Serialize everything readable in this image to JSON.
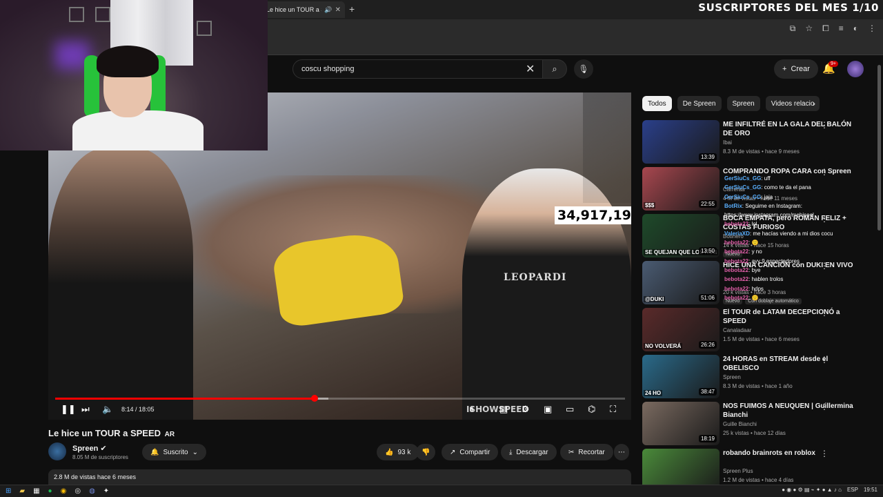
{
  "overlay": {
    "title": "SUSCRIPTORES DEL MES 1/10",
    "viewer_counter": "34,917,19"
  },
  "browser": {
    "tab_title": "Le hice un TOUR a SP",
    "new_tab": "+",
    "close": "✕"
  },
  "header": {
    "search_value": "coscu shopping",
    "create_label": "Crear",
    "notif_count": "9+"
  },
  "player": {
    "current_time": "8:14",
    "duration": "18:05",
    "time_display": "8:14 / 18:05",
    "progress": 0.455,
    "shirt_print": "LEOPARDI",
    "watermark": "ISHOWSPEED"
  },
  "video": {
    "title": "Le hice un TOUR a SPEED",
    "title_flag": "AR",
    "channel": "Spreen",
    "subscribers": "8.05 M de suscriptores",
    "subscribed_label": "Suscrito",
    "likes": "93 k",
    "share_label": "Compartir",
    "download_label": "Descargar",
    "clip_label": "Recortar",
    "views_date": "2.8 M de vistas  hace 6 meses"
  },
  "chips": [
    "Todos",
    "De Spreen",
    "Spreen",
    "Videos relacio"
  ],
  "recommendations": [
    {
      "title": "ME INFILTRÉ EN LA GALA DEL BALÓN DE ORO",
      "channel": "Ibai",
      "meta": "8.3 M de vistas • hace 9 meses",
      "duration": "13:39",
      "color": "#2a3f8a"
    },
    {
      "title": "COMPRANDO ROPA CARA con Spreen",
      "channel": "Carreraa",
      "meta": "4 M de vistas • hace 11 meses",
      "duration": "22:55",
      "color": "#a8474f",
      "label": "$$$"
    },
    {
      "title": "BOCA EMPATA, pero ROMÁN FELIZ + COSTAS FURIOSO",
      "channel": "Botinero",
      "meta": "14 k vistas • hace 15 horas",
      "duration": "13:50",
      "color": "#1e4a2a",
      "label": "SE QUEJAN QUE LOS ROB",
      "tag": "Nuevo"
    },
    {
      "title": "HICE UNA CANCIÓN con DUKI EN VIVO",
      "channel": "",
      "meta": "20 k vistas • hace 3 horas",
      "duration": "51:06",
      "color": "#4a5b72",
      "label": "@DUKI",
      "tag": "Nuevo",
      "tag2": "Con doblaje automático"
    },
    {
      "title": "El TOUR de LATAM DECEPCIONÓ a SPEED",
      "channel": "Canaladaar",
      "meta": "1.5 M de vistas • hace 6 meses",
      "duration": "26:26",
      "color": "#5a2a2a",
      "label": "NO VOLVERÁ"
    },
    {
      "title": "24 HORAS en STREAM desde el OBELISCO",
      "channel": "Spreen",
      "meta": "8.3 M de vistas • hace 1 año",
      "duration": "38:47",
      "color": "#2a6a8a",
      "label": "24 HO"
    },
    {
      "title": "NOS FUIMOS A NEUQUEN | Guillermina Bianchi",
      "channel": "Guille Bianchi",
      "meta": "25 k vistas • hace 12 días",
      "duration": "18:19",
      "color": "#7a6a60"
    },
    {
      "title": "robando brainrots en roblox",
      "channel": "Spreen Plus",
      "meta": "1.2 M de vistas • hace 4 días",
      "duration": "",
      "color": "#4a8a3a"
    }
  ],
  "chat": [
    {
      "user": "GerSiuCs_GG",
      "msg": ": uff",
      "c": "u"
    },
    {
      "user": "GerSiuCs_GG",
      "msg": ": como te da el pana",
      "c": "u"
    },
    {
      "user": "GerSiuCs_GG",
      "msg": ": jaja",
      "c": "u"
    },
    {
      "user": "BotRix",
      "msg": ": Seguime en Instagram: https://www.instagram.com/mehiseel",
      "c": "u"
    },
    {
      "user": "bebota22",
      "msg": ": lol",
      "c": "u2"
    },
    {
      "user": "ValeriaXD",
      "msg": ": me hacías viendo a mi dios cocu",
      "c": "u"
    },
    {
      "user": "bebota22",
      "msg": ": 🙂",
      "c": "u2"
    },
    {
      "user": "bebota22",
      "msg": ": y no",
      "c": "u2"
    },
    {
      "user": "bebota22",
      "msg": ": ayy 9 espectadores",
      "c": "u2"
    },
    {
      "user": "bebota22",
      "msg": ": bye",
      "c": "u2"
    },
    {
      "user": "bebota22",
      "msg": ": hablen trolos",
      "c": "u2"
    },
    {
      "user": "bebota22",
      "msg": ": hdps",
      "c": "u2"
    },
    {
      "user": "bebota22",
      "msg": ": 🙂",
      "c": "u2"
    }
  ],
  "taskbar": {
    "lang": "ESP",
    "clock": "19:51"
  }
}
